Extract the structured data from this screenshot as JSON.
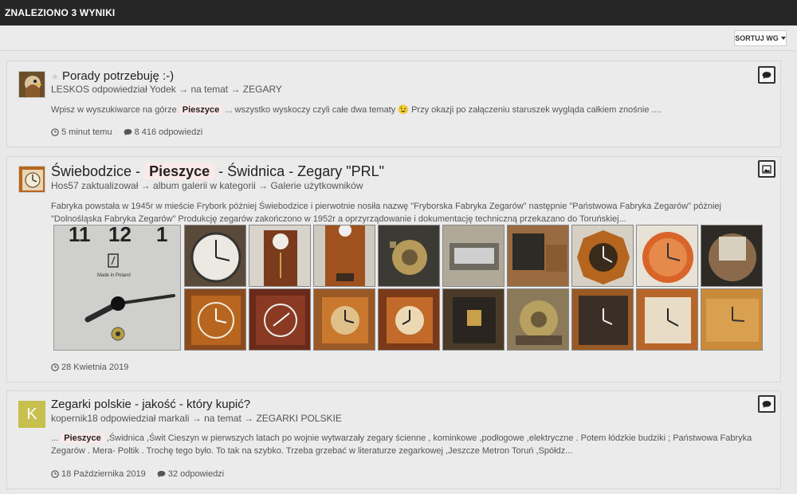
{
  "header": {
    "title": "ZNALEZIONO 3 WYNIKI"
  },
  "toolbar": {
    "sort_label": "SORTUJ WG"
  },
  "results": [
    {
      "title": "Porady potrzebuję :-)",
      "sub": "LESKOS odpowiedział Yodek → na temat → ZEGARY",
      "snippet_before": "Wpisz w wyszukiwarce na górze",
      "highlight": "Pieszyce",
      "snippet_after": "... wszystko wyskoczy czyli całe dwa tematy 😉 Przy okazji po załączeniu staruszek wygląda całkiem znośnie ....",
      "time": "5 minut temu",
      "replies": "8 416 odpowiedzi"
    },
    {
      "title_before": "Świebodzice -",
      "highlight": "Pieszyce",
      "title_after": "- Świdnica - Zegary \"PRL\"",
      "sub": "Hos57 zaktualizował → album galerii w kategorii → Galerie użytkowników",
      "snippet": "Fabryka powstała w 1945r w mieście Frybork póżniej Świebodzice i pierwotnie nosiła nazwę \"Fryborska Fabryka Zegarów\" następnie \"Państwowa Fabryka Zegarów\" póżniej \"Dolnośląska Fabryka Zegarów\" Produkcję zegarów zakończono w 1952r a oprzyrządowanie i dokumentację techniczną przekazano do Toruńskiej...",
      "time": "28 Kwietnia 2019",
      "photo_label": "Made in Poland"
    },
    {
      "title": "Zegarki polskie - jakość - który kupić?",
      "avatar_letter": "K",
      "sub": "kopernik18 odpowiedział markali → na temat → ZEGARKI POLSKIE",
      "snippet_prefix": "...",
      "highlight": "Pieszyce",
      "snippet_after": ",Świdnica ,Świt Cieszyn w pierwszych latach po wojnie wytwarzały zegary ścienne , kominkowe ,podłogowe ,elektryczne . Potem łódzkie budziki ; Państwowa Fabryka Zegarów . Mera- Poltik . Trochę tego było. To tak na szybko. Trzeba grzebać w literaturze zegarkowej ,Jeszcze Metron Toruń ,Spółdz...",
      "time": "18 Października 2019",
      "replies": "32 odpowiedzi"
    }
  ],
  "icons": {
    "clock": "clock-icon",
    "comment": "comment-icon",
    "topic": "topic-type-icon",
    "image": "image-type-icon"
  },
  "colors": {
    "header_bg": "#262626",
    "highlight_bg": "#fde9ea",
    "avatar_k_bg": "#c8c04e"
  }
}
